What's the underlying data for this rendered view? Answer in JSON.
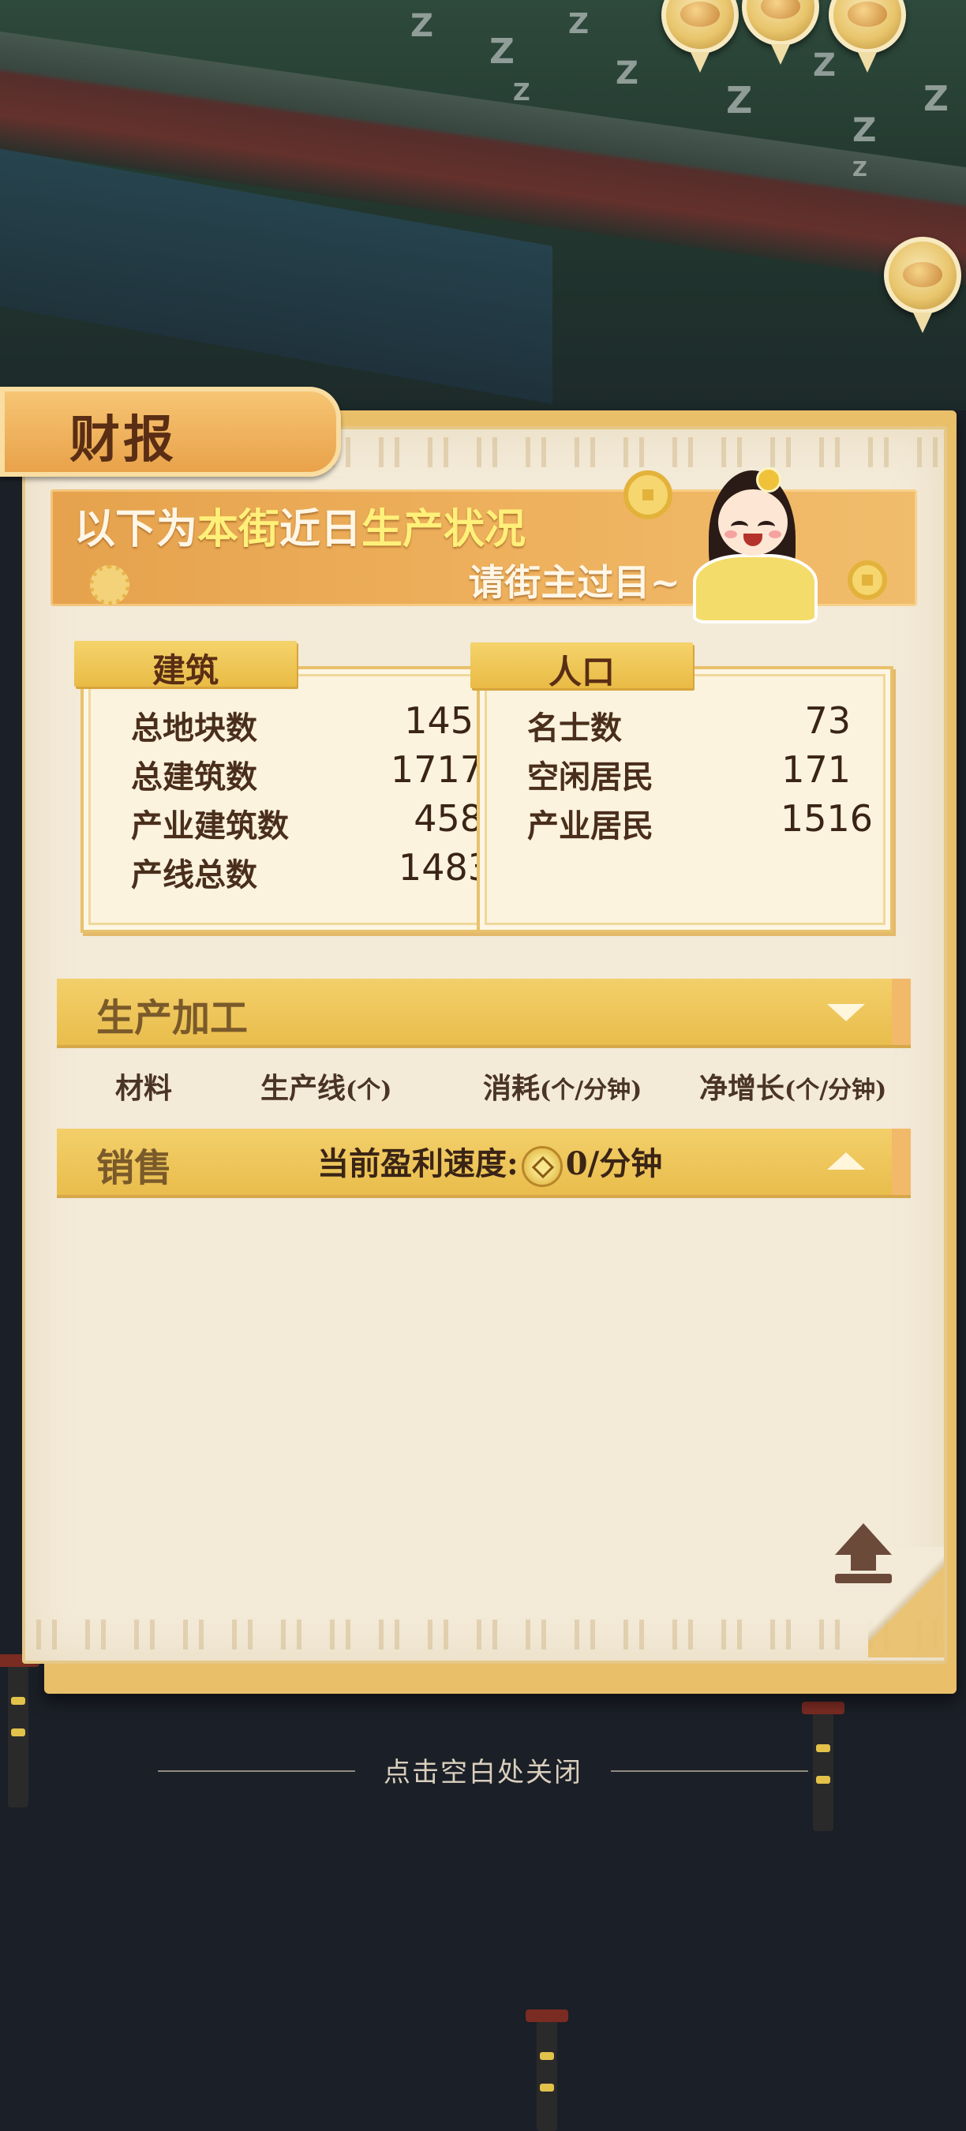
{
  "panel": {
    "title": "财报",
    "banner": {
      "line1_prefix": "以下为",
      "line1_hl1": "本街",
      "line1_mid": "近日",
      "line1_hl2": "生产状况",
      "line2": "请街主过目~"
    }
  },
  "buildings": {
    "title": "建筑",
    "rows": [
      {
        "label": "总地块数",
        "value": "145"
      },
      {
        "label": "总建筑数",
        "value": "1717"
      },
      {
        "label": "产业建筑数",
        "value": "458"
      },
      {
        "label": "产线总数",
        "value": "1483"
      }
    ]
  },
  "population": {
    "title": "人口",
    "rows": [
      {
        "label": "名士数",
        "value": "73"
      },
      {
        "label": "空闲居民",
        "value": "171"
      },
      {
        "label": "产业居民",
        "value": "1516"
      }
    ]
  },
  "production": {
    "title": "生产加工",
    "columns": {
      "material": "材料",
      "lines": "生产线",
      "lines_unit": "(个)",
      "consume": "消耗",
      "consume_unit": "(个/分钟)",
      "net": "净增长",
      "net_unit": "(个/分钟)"
    }
  },
  "sales": {
    "title": "销售",
    "profit_label": "当前盈利速度:",
    "profit_value": "0/分钟"
  },
  "footer": {
    "close_hint": "点击空白处关闭"
  },
  "colors": {
    "panel_bg": "#f3ead8",
    "section_gold": "#e9bd4c",
    "banner_orange": "#e6a24d",
    "dark_bg": "#1b1f27"
  },
  "icons": [
    "coin-icon",
    "chevron-down-icon",
    "chevron-up-icon",
    "scroll-top-icon",
    "map-pin-icon"
  ]
}
